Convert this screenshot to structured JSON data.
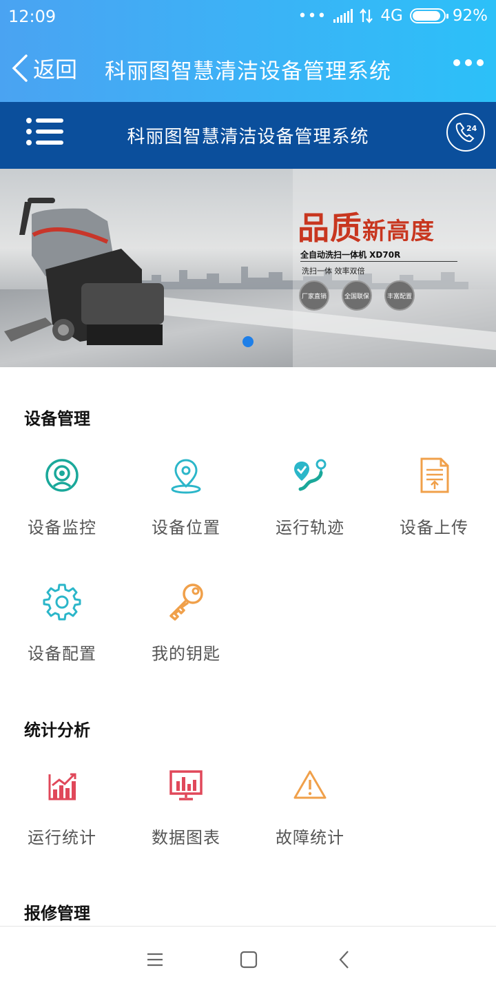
{
  "status_bar": {
    "time": "12:09",
    "signal_dots": "•••",
    "network": "4G",
    "battery": "92%",
    "battery_level": 0.92
  },
  "title_bar": {
    "back_label": "返回",
    "title": "科丽图智慧清洁设备管理系统"
  },
  "app_header": {
    "title": "科丽图智慧清洁设备管理系统",
    "phone_badge": "24"
  },
  "banner": {
    "headline_big": "品质",
    "headline_small": "新高度",
    "product_line": "全自动洗扫一体机    XD70R",
    "tagline": "洗扫一体  效率双倍",
    "badges": [
      "厂家直销",
      "全国联保",
      "丰富配置"
    ],
    "active_slide": 1,
    "slide_count": 1
  },
  "sections": {
    "device_mgmt": {
      "title": "设备管理",
      "items": [
        {
          "label": "设备监控",
          "icon": "camera-monitor-icon",
          "color": "#1aa89a"
        },
        {
          "label": "设备位置",
          "icon": "location-pin-icon",
          "color": "#2bb6c9"
        },
        {
          "label": "运行轨迹",
          "icon": "route-track-icon",
          "color": "#2bb6c9"
        },
        {
          "label": "设备上传",
          "icon": "document-upload-icon",
          "color": "#f0a04a"
        },
        {
          "label": "设备配置",
          "icon": "gear-icon",
          "color": "#2bb6c9"
        },
        {
          "label": "我的钥匙",
          "icon": "key-icon",
          "color": "#f0a04a"
        }
      ]
    },
    "stats": {
      "title": "统计分析",
      "items": [
        {
          "label": "运行统计",
          "icon": "trend-chart-icon",
          "color": "#e0485a"
        },
        {
          "label": "数据图表",
          "icon": "bar-chart-board-icon",
          "color": "#e0485a"
        },
        {
          "label": "故障统计",
          "icon": "warning-icon",
          "color": "#f0a04a"
        }
      ]
    },
    "repair": {
      "title": "报修管理"
    }
  },
  "nav_bar": {
    "buttons": [
      "menu-icon",
      "home-square-icon",
      "back-chevron-icon"
    ]
  }
}
